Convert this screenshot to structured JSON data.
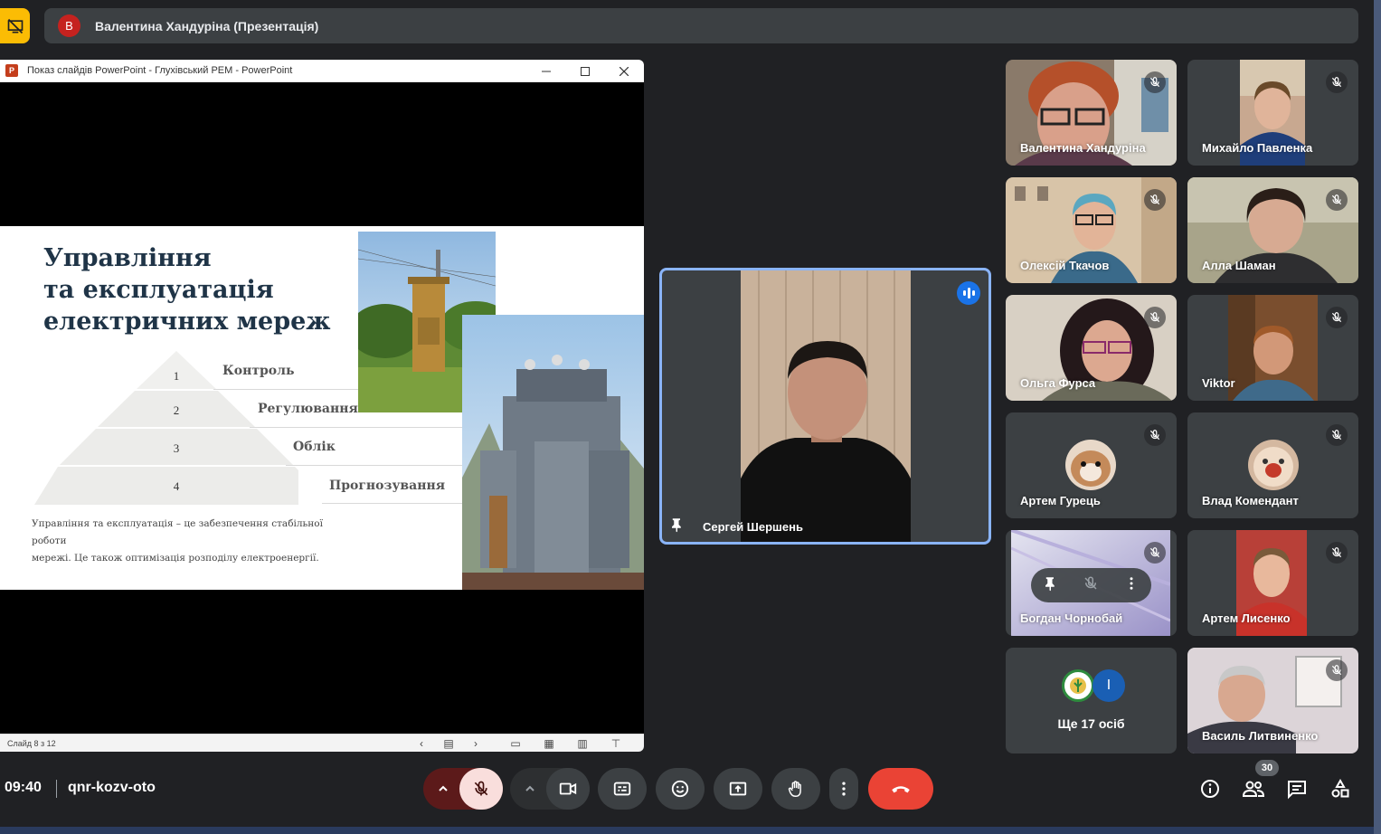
{
  "presenter": {
    "avatar_letter": "В",
    "label": "Валентина Хандуріна (Презентація)"
  },
  "ppt_window": {
    "title": "Показ слайдів PowerPoint  -  Глухівський РЕМ - PowerPoint",
    "logo": "P",
    "status": "Слайд 8 з 12"
  },
  "slide": {
    "title_lines": [
      "Управління",
      "та експлуатація",
      "електричних мереж"
    ],
    "pyramid": [
      {
        "num": "1",
        "label": "Контроль"
      },
      {
        "num": "2",
        "label": "Регулювання"
      },
      {
        "num": "3",
        "label": "Облік"
      },
      {
        "num": "4",
        "label": "Прогнозування"
      }
    ],
    "description_lines": [
      "Управління та експлуатація – це забезпечення стабільної роботи",
      "мережі. Це також оптимізація розподілу електроенергії."
    ]
  },
  "main_speaker": {
    "name": "Сергей Шершень"
  },
  "participants": [
    {
      "name": "Валентина Хандуріна",
      "muted": true
    },
    {
      "name": "Михайло Павленка",
      "muted": true
    },
    {
      "name": "Олексій Ткачов",
      "muted": true
    },
    {
      "name": "Алла Шаман",
      "muted": true
    },
    {
      "name": "Ольга Фурса",
      "muted": true
    },
    {
      "name": "Viktor",
      "muted": true
    },
    {
      "name": "Артем Гурець",
      "muted": true
    },
    {
      "name": "Влад Комендант",
      "muted": true
    },
    {
      "name": "Богдан Чорнобай",
      "muted": true
    },
    {
      "name": "Артем Лисенко",
      "muted": true
    },
    {
      "name": "Ще 17 осіб",
      "muted": false
    },
    {
      "name": "Василь Литвиненко",
      "muted": true
    }
  ],
  "more_tile": {
    "avatar_letter": "І"
  },
  "footer": {
    "time": "09:40",
    "meeting_code": "qnr-kozv-oto",
    "people_count": "30"
  },
  "colors": {
    "background": "#202124",
    "tile": "#3c4043",
    "present_accent": "#fbbc04",
    "end_call": "#ea4335",
    "mic_off": "#f9dedc",
    "active_border": "#8ab4f8",
    "speaking": "#1a73e8"
  },
  "icons": [
    "presenting-icon",
    "mic-off-icon",
    "camera-icon",
    "captions-icon",
    "emoji-icon",
    "present-screen-icon",
    "raise-hand-icon",
    "more-options-icon",
    "end-call-icon",
    "info-icon",
    "people-icon",
    "chat-icon",
    "activities-icon",
    "pin-icon"
  ]
}
